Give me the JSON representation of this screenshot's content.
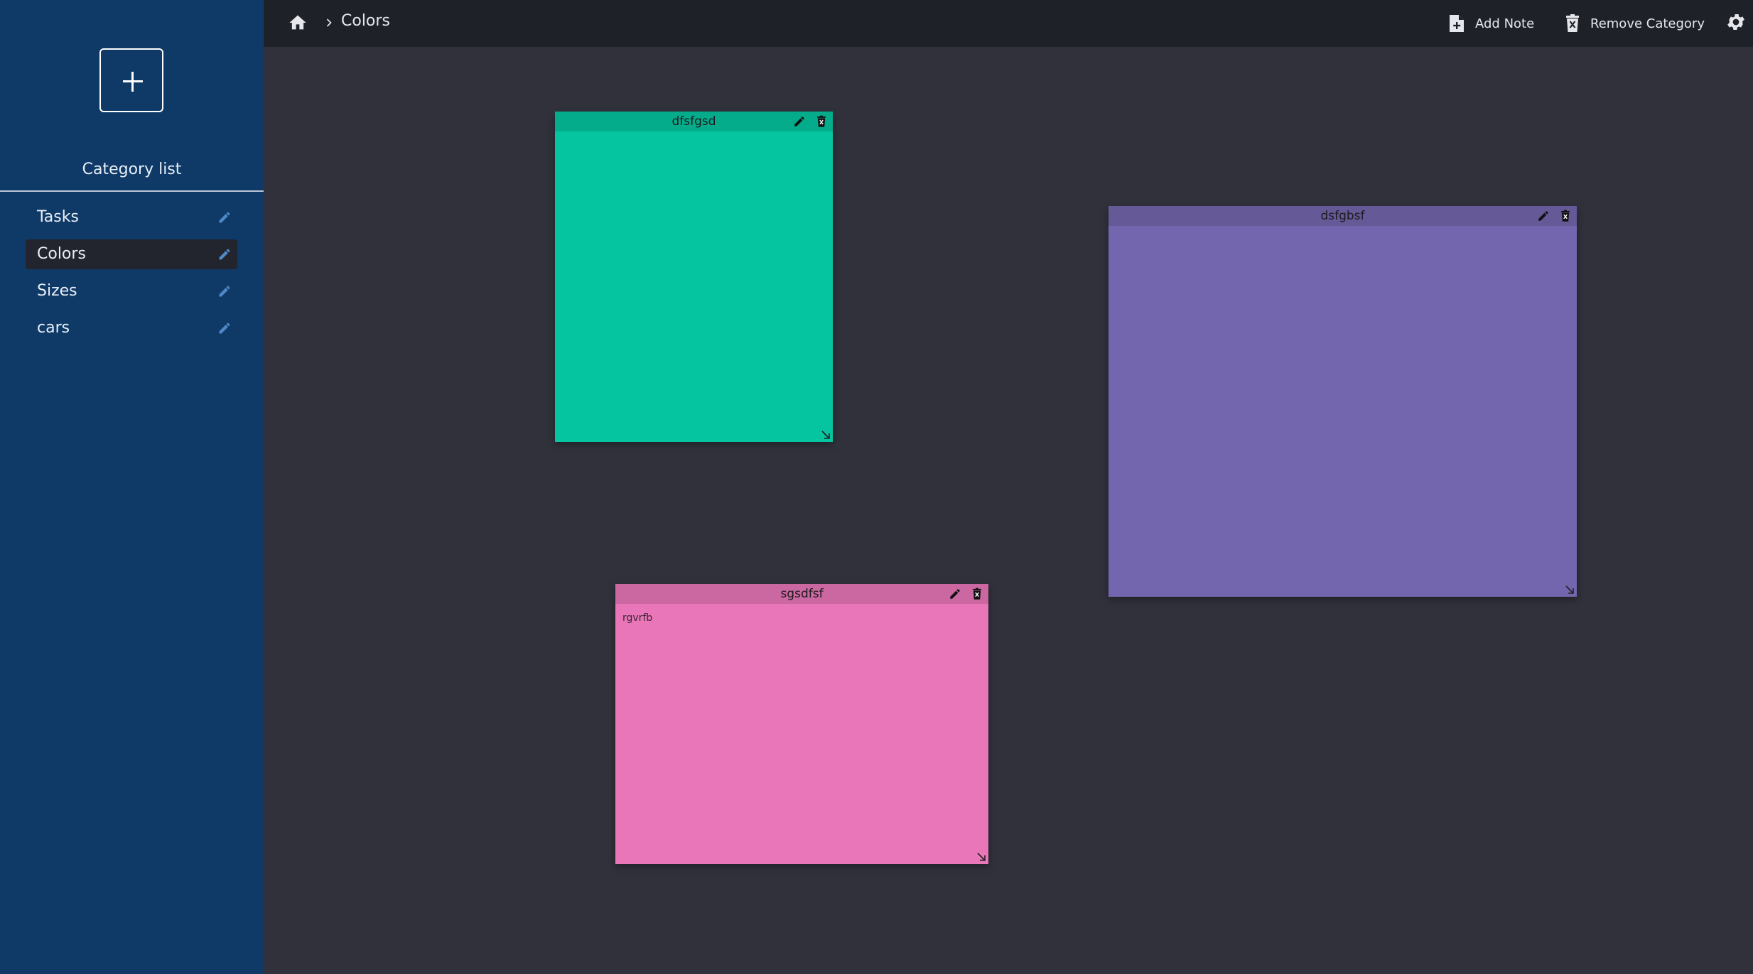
{
  "sidebar": {
    "add_icon": "plus-icon",
    "title": "Category list",
    "items": [
      {
        "label": "Tasks",
        "active": false
      },
      {
        "label": "Colors",
        "active": true
      },
      {
        "label": "Sizes",
        "active": false
      },
      {
        "label": "cars",
        "active": false
      }
    ]
  },
  "topbar": {
    "home_icon": "home-icon",
    "breadcrumb_current": "Colors",
    "add_note_label": "Add Note",
    "remove_category_label": "Remove Category",
    "settings_icon": "gear-icon"
  },
  "notes": [
    {
      "title": "dfsfgsd",
      "body": "",
      "color": "#05c4a0"
    },
    {
      "title": "dsfgbsf",
      "body": "",
      "color": "#7466ae"
    },
    {
      "title": "sgsdfsf",
      "body": "rgvrfb",
      "color": "#e876b8"
    }
  ],
  "colors": {
    "sidebar_bg": "#0f3a68",
    "topbar_bg": "#1f2129",
    "canvas_bg": "#30313b",
    "active_item_bg": "#22252d",
    "edit_icon": "#4f88c6"
  }
}
